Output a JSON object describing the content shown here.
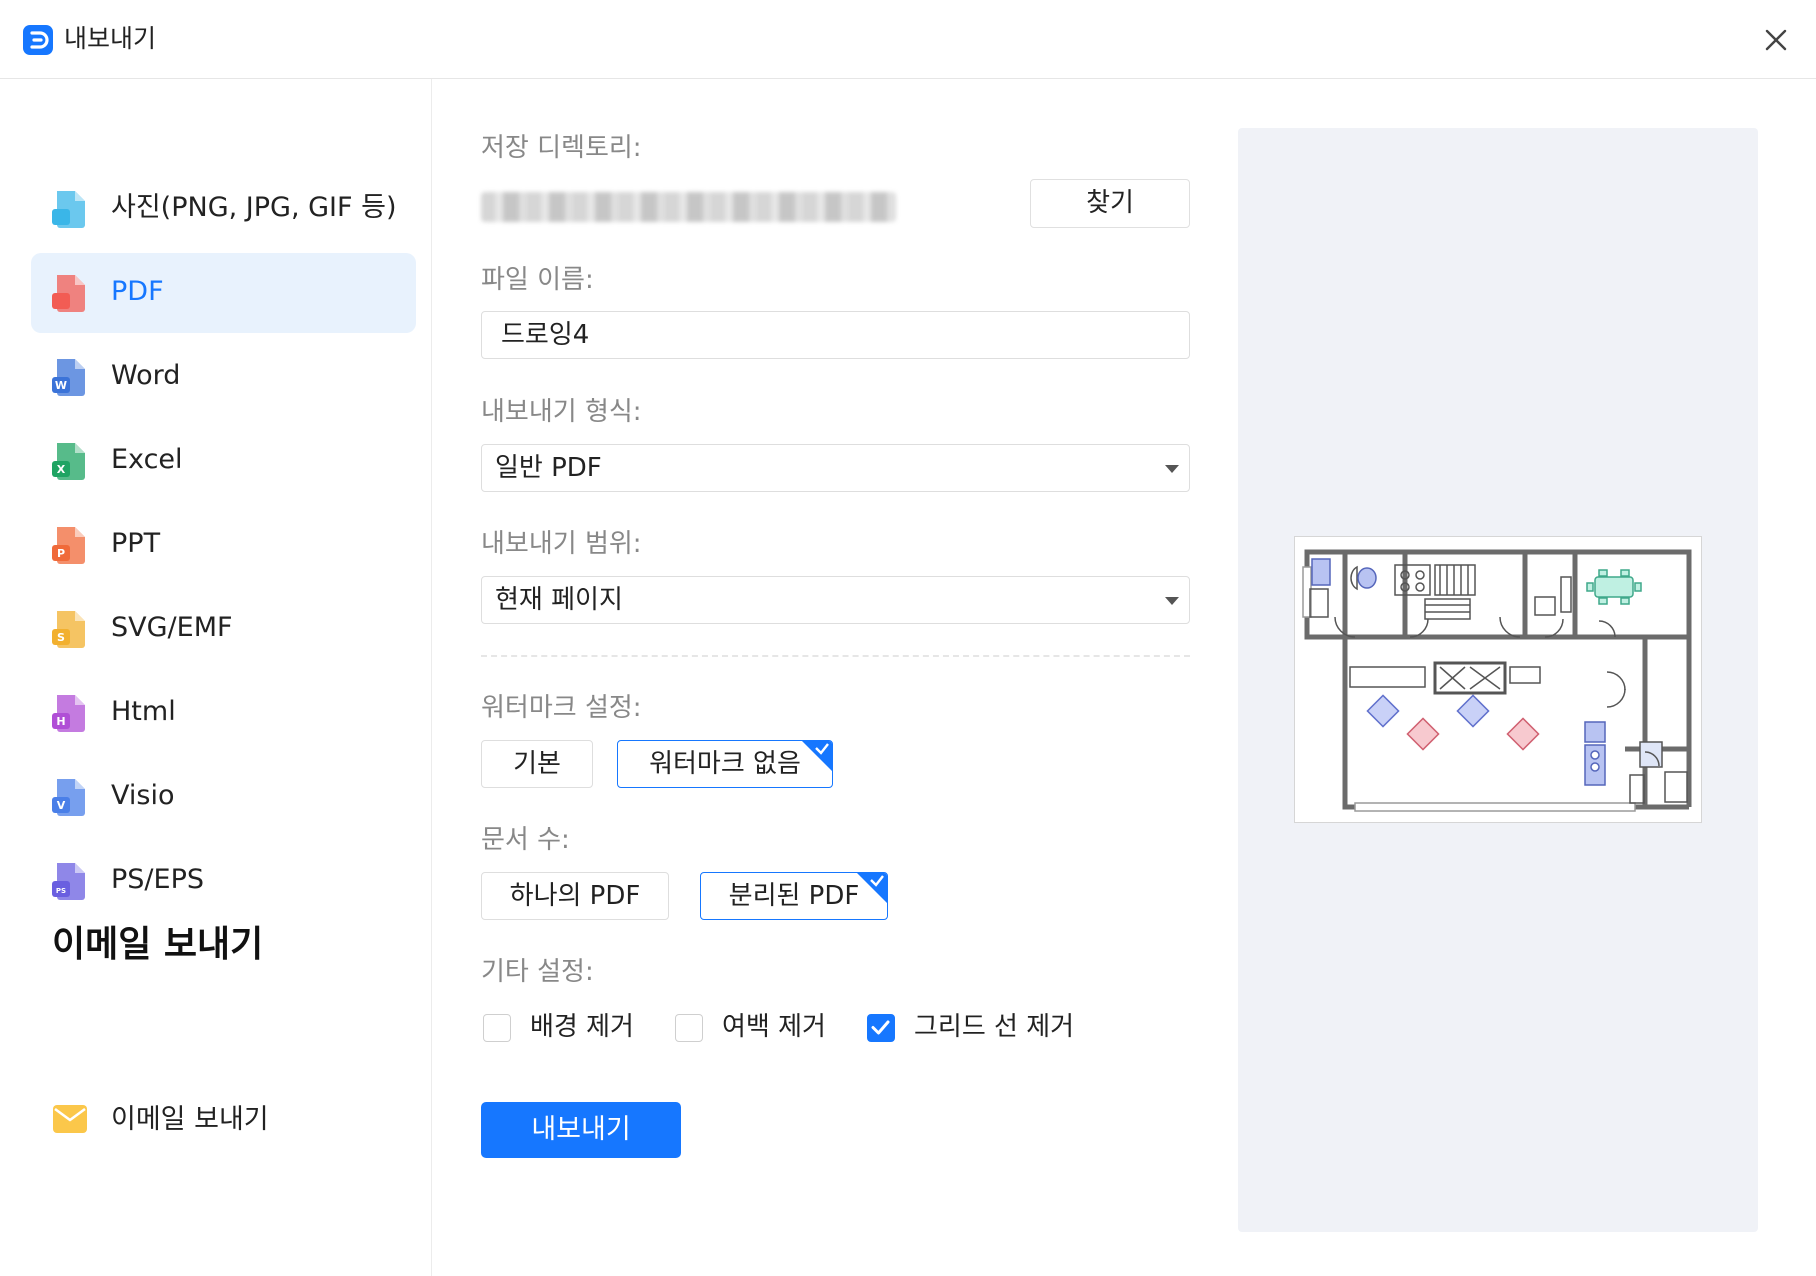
{
  "window": {
    "title": "내보내기",
    "brand_color": "#1677ff"
  },
  "sidebar": {
    "items": [
      {
        "label": "사진(PNG, JPG, GIF 등)",
        "icon": "image-file-icon",
        "color": "#3ab6e8",
        "letter": ""
      },
      {
        "label": "PDF",
        "icon": "pdf-file-icon",
        "color": "#f25c54",
        "letter": ""
      },
      {
        "label": "Word",
        "icon": "word-file-icon",
        "color": "#3b73d8",
        "letter": "W"
      },
      {
        "label": "Excel",
        "icon": "excel-file-icon",
        "color": "#1fa463",
        "letter": "X"
      },
      {
        "label": "PPT",
        "icon": "ppt-file-icon",
        "color": "#f06a3a",
        "letter": "P"
      },
      {
        "label": "SVG/EMF",
        "icon": "svg-file-icon",
        "color": "#f2b02f",
        "letter": "S"
      },
      {
        "label": "Html",
        "icon": "html-file-icon",
        "color": "#b04fd6",
        "letter": "H"
      },
      {
        "label": "Visio",
        "icon": "visio-file-icon",
        "color": "#4a7fe8",
        "letter": "V"
      },
      {
        "label": "PS/EPS",
        "icon": "ps-file-icon",
        "color": "#6a5fe0",
        "letter": "PS"
      }
    ],
    "active_index": 1,
    "email_heading": "이메일 보내기",
    "email_item": {
      "label": "이메일 보내기",
      "icon": "mail-icon"
    }
  },
  "form": {
    "save_dir_label": "저장 디렉토리:",
    "browse_label": "찾기",
    "file_name_label": "파일 이름:",
    "file_name_value": "드로잉4",
    "format_label": "내보내기 형식:",
    "format_value": "일반 PDF",
    "range_label": "내보내기 범위:",
    "range_value": "현재 페이지",
    "watermark_label": "워터마크 설정:",
    "watermark_options": [
      "기본",
      "워터마크 없음"
    ],
    "watermark_selected": 1,
    "doc_count_label": "문서 수:",
    "doc_count_options": [
      "하나의 PDF",
      "분리된 PDF"
    ],
    "doc_count_selected": 1,
    "other_label": "기타 설정:",
    "other_options": [
      {
        "label": "배경 제거",
        "checked": false
      },
      {
        "label": "여백 제거",
        "checked": false
      },
      {
        "label": "그리드 선 제거",
        "checked": true
      }
    ],
    "export_button": "내보내기"
  }
}
